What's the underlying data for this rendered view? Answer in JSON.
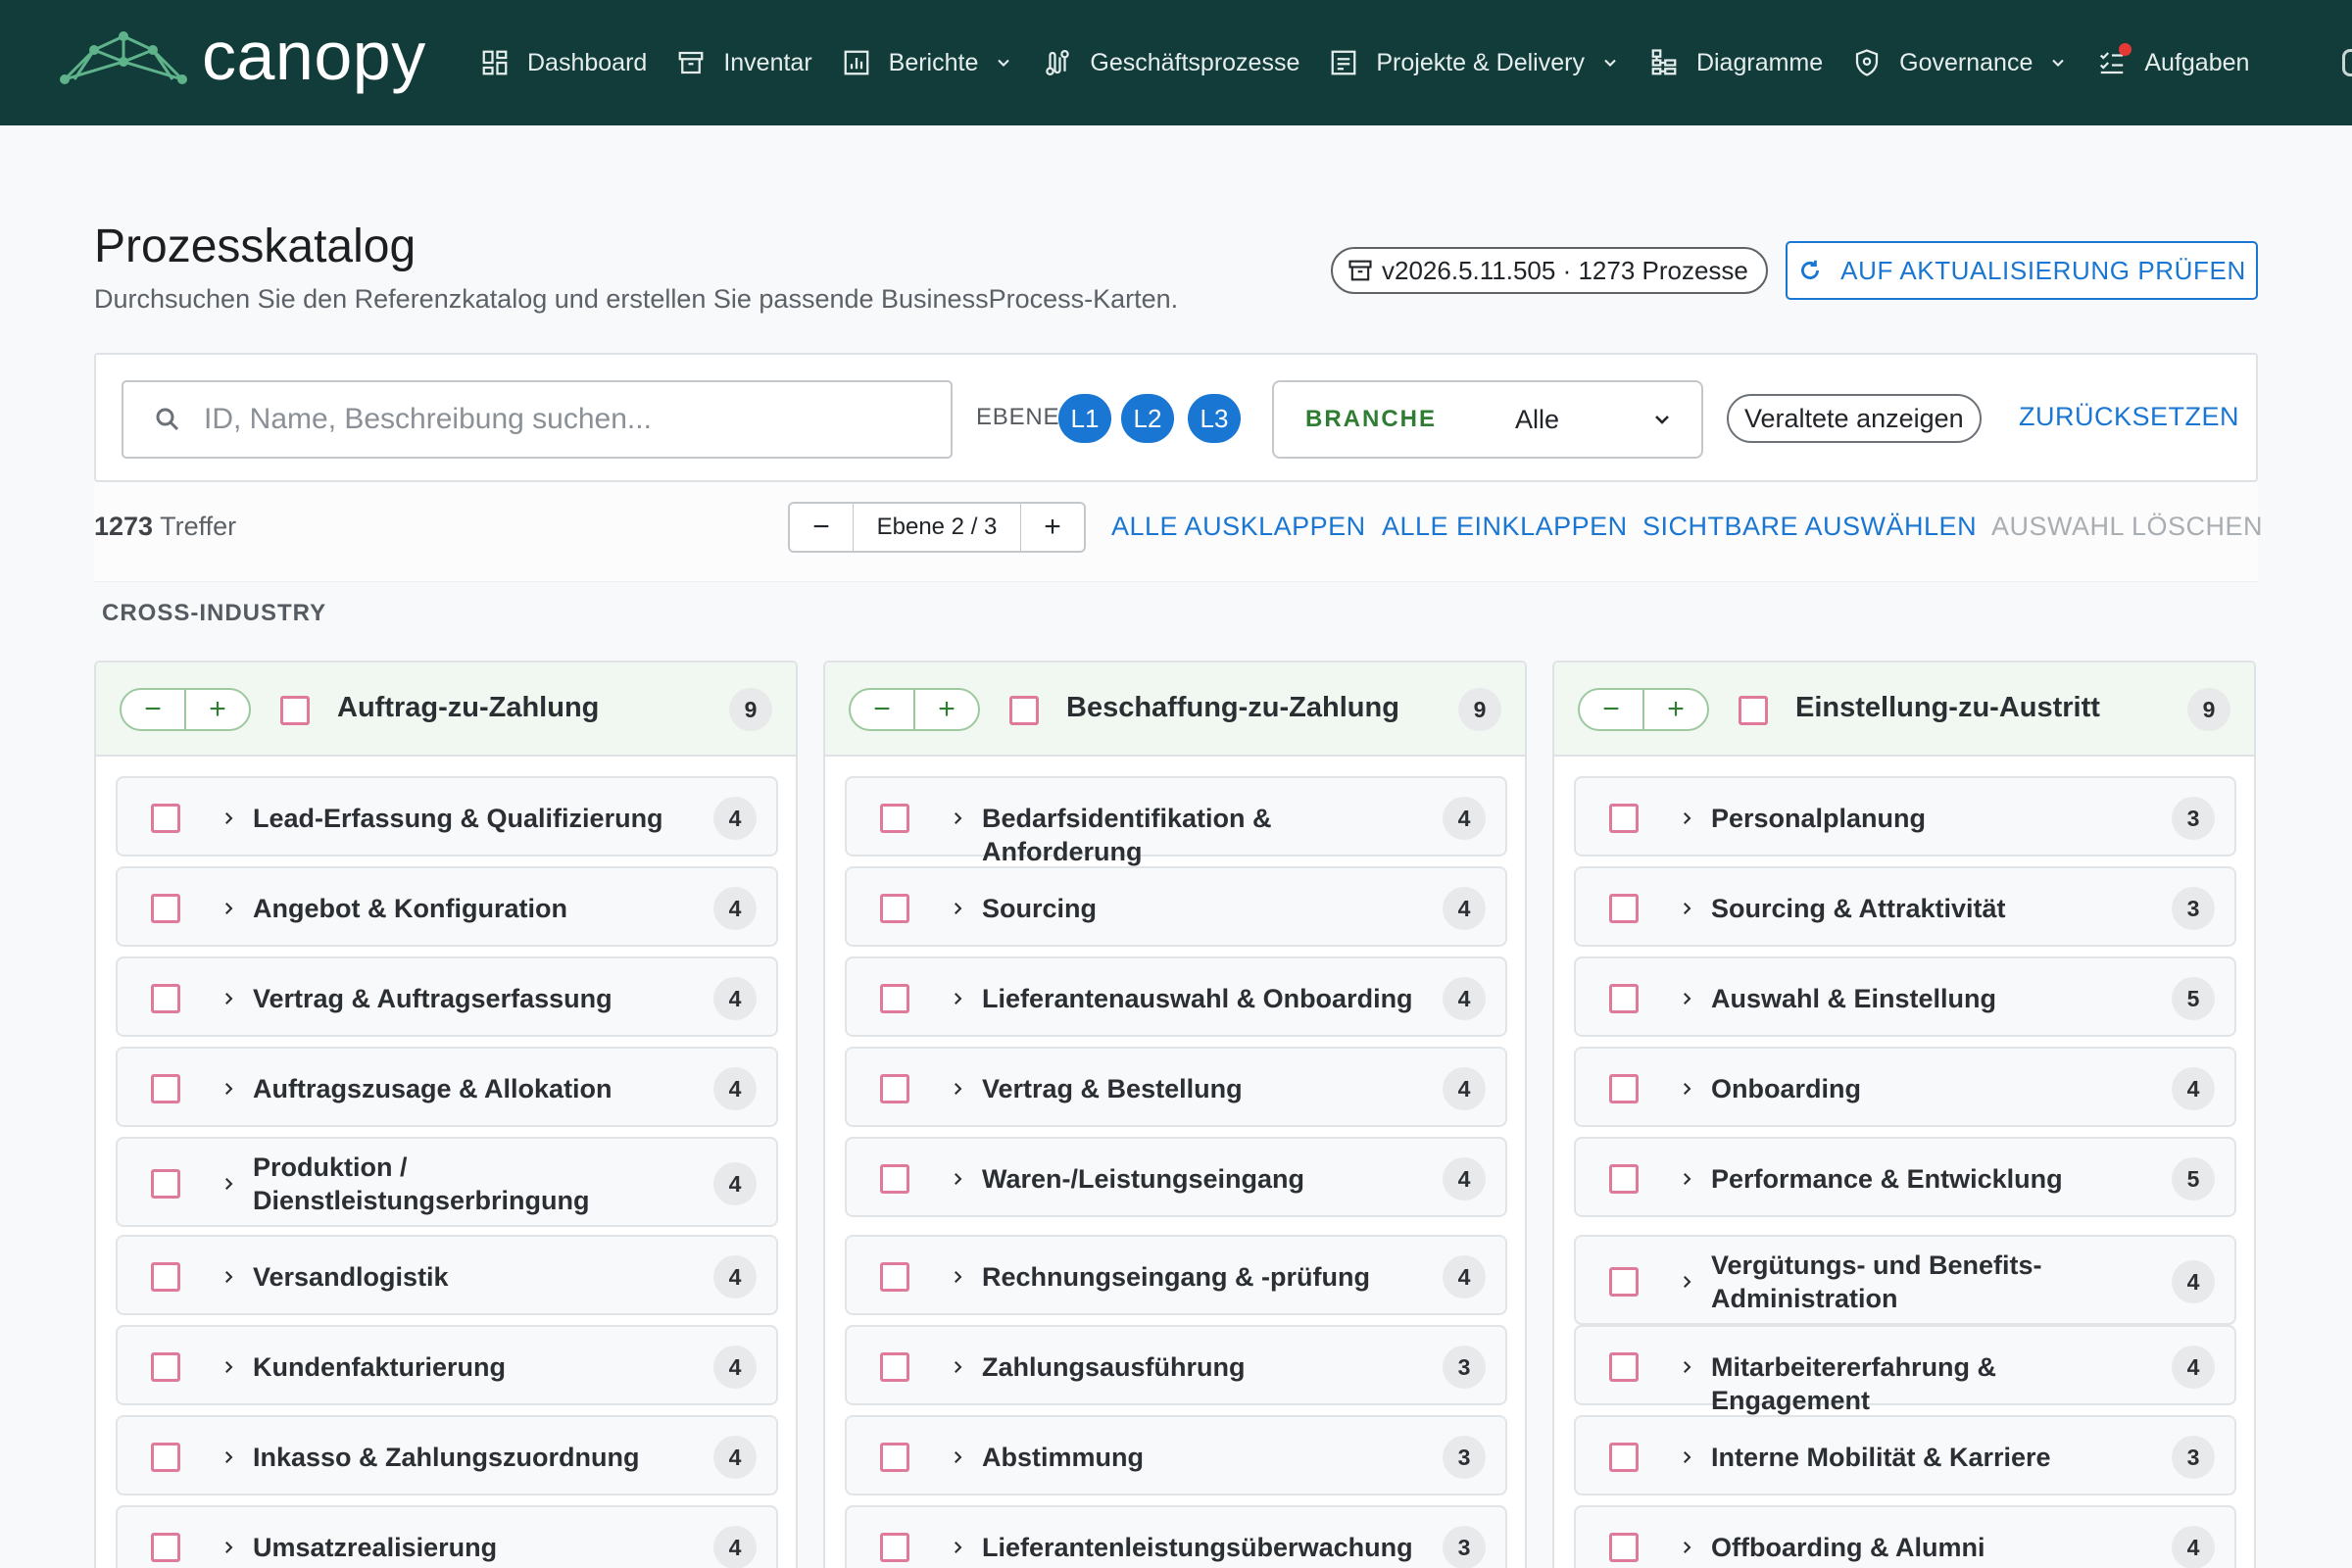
{
  "nav": {
    "logo_text": "canopy",
    "items": [
      {
        "label": "Dashboard",
        "icon": "dashboard-icon",
        "dropdown": false
      },
      {
        "label": "Inventar",
        "icon": "archive-icon",
        "dropdown": false
      },
      {
        "label": "Berichte",
        "icon": "bar-chart-icon",
        "dropdown": true
      },
      {
        "label": "Geschäftsprozesse",
        "icon": "process-flow-icon",
        "dropdown": false
      },
      {
        "label": "Projekte & Delivery",
        "icon": "project-icon",
        "dropdown": true
      },
      {
        "label": "Diagramme",
        "icon": "hierarchy-icon",
        "dropdown": false
      },
      {
        "label": "Governance",
        "icon": "shield-icon",
        "dropdown": true
      },
      {
        "label": "Aufgaben",
        "icon": "checklist-icon",
        "dropdown": false
      }
    ]
  },
  "header": {
    "title": "Prozesskatalog",
    "subtitle": "Durchsuchen Sie den Referenzkatalog und erstellen Sie passende BusinessProcess-Karten.",
    "version": "v2026.5.11.505 · 1273 Prozesse",
    "update_button": "AUF AKTUALISIERUNG PRÜFEN"
  },
  "filters": {
    "search_placeholder": "ID, Name, Beschreibung suchen...",
    "level_label": "EBENE",
    "levels": [
      "L1",
      "L2",
      "L3"
    ],
    "branche_label": "BRANCHE",
    "branche_value": "Alle",
    "outdated_label": "Veraltete anzeigen",
    "reset_label": "ZURÜCKSETZEN"
  },
  "toolbar": {
    "hits_count": "1273",
    "hits_label": "Treffer",
    "level_stepper": "Ebene 2 / 3",
    "minus": "−",
    "plus": "+",
    "expand_all": "ALLE AUSKLAPPEN",
    "collapse_all": "ALLE EINKLAPPEN",
    "select_visible": "SICHTBARE AUSWÄHLEN",
    "clear_selection": "AUSWAHL LÖSCHEN"
  },
  "section": "CROSS-INDUSTRY",
  "columns": [
    {
      "title": "Auftrag-zu-Zahlung",
      "count": "9",
      "rows": [
        {
          "label": "Lead-Erfassung & Qualifizierung",
          "count": "4"
        },
        {
          "label": "Angebot & Konfiguration",
          "count": "4"
        },
        {
          "label": "Vertrag & Auftragserfassung",
          "count": "4"
        },
        {
          "label": "Auftragszusage & Allokation",
          "count": "4"
        },
        {
          "label": "Produktion / Dienstleistungserbringung",
          "count": "4"
        },
        {
          "label": "Versandlogistik",
          "count": "4"
        },
        {
          "label": "Kundenfakturierung",
          "count": "4"
        },
        {
          "label": "Inkasso & Zahlungszuordnung",
          "count": "4"
        },
        {
          "label": "Umsatzrealisierung",
          "count": "4"
        }
      ]
    },
    {
      "title": "Beschaffung-zu-Zahlung",
      "count": "9",
      "rows": [
        {
          "label": "Bedarfsidentifikation & Anforderung",
          "count": "4"
        },
        {
          "label": "Sourcing",
          "count": "4"
        },
        {
          "label": "Lieferantenauswahl & Onboarding",
          "count": "4"
        },
        {
          "label": "Vertrag & Bestellung",
          "count": "4"
        },
        {
          "label": "Waren-/Leistungseingang",
          "count": "4"
        },
        {
          "label": "Rechnungseingang & -prüfung",
          "count": "4"
        },
        {
          "label": "Zahlungsausführung",
          "count": "3"
        },
        {
          "label": "Abstimmung",
          "count": "3"
        },
        {
          "label": "Lieferantenleistungsüberwachung",
          "count": "3"
        }
      ]
    },
    {
      "title": "Einstellung-zu-Austritt",
      "count": "9",
      "rows": [
        {
          "label": "Personalplanung",
          "count": "3"
        },
        {
          "label": "Sourcing & Attraktivität",
          "count": "3"
        },
        {
          "label": "Auswahl & Einstellung",
          "count": "5"
        },
        {
          "label": "Onboarding",
          "count": "4"
        },
        {
          "label": "Performance & Entwicklung",
          "count": "5"
        },
        {
          "label": "Vergütungs- und Benefits-Administration",
          "count": "4"
        },
        {
          "label": "Mitarbeitererfahrung & Engagement",
          "count": "4"
        },
        {
          "label": "Interne Mobilität & Karriere",
          "count": "3"
        },
        {
          "label": "Offboarding & Alumni",
          "count": "4"
        }
      ]
    }
  ]
}
